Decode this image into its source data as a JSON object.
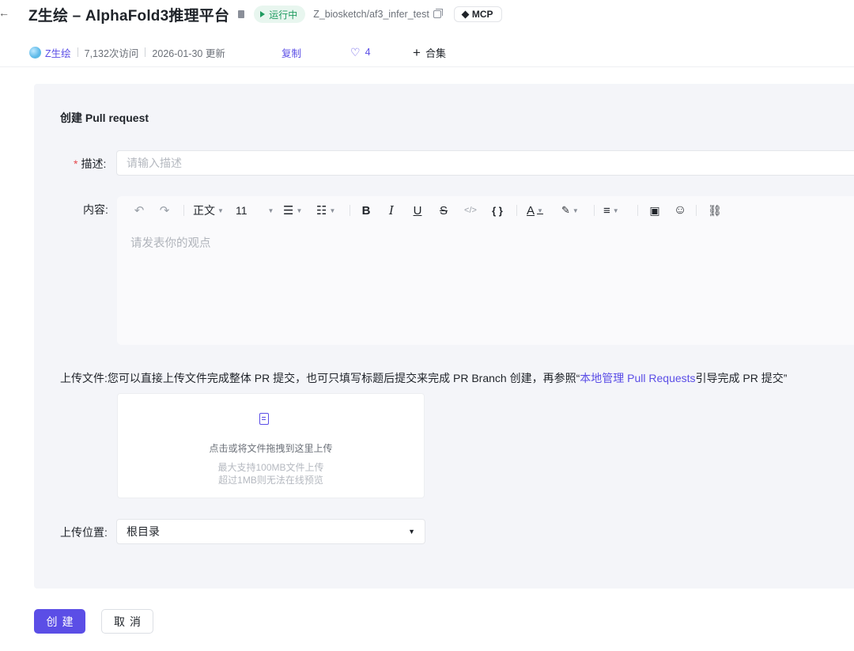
{
  "header": {
    "back_glyph": "←",
    "title": "Z生绘 – AlphaFold3推理平台",
    "status": "运行中",
    "repo_path": "Z_biosketch/af3_infer_test",
    "mcp_label": "MCP"
  },
  "meta": {
    "org_name": "Z生绘",
    "visits": "7,132次访问",
    "updated": "2026-01-30 更新",
    "copy_label": "复制",
    "likes": "4",
    "collection_label": "合集"
  },
  "form": {
    "title": "创建 Pull request",
    "description": {
      "required_mark": "*",
      "label": "描述:",
      "placeholder": "请输入描述",
      "value": ""
    },
    "content": {
      "label": "内容:",
      "placeholder": "请发表你的观点",
      "toolbar": {
        "paragraph_style": "正文",
        "font_size": "11"
      }
    },
    "upload": {
      "label": "上传文件:",
      "hint_prefix": "您可以直接上传文件完成整体 PR 提交，也可只填写标题后提交来完成 PR Branch 创建，再参照“",
      "hint_link": "本地管理 Pull Requests",
      "hint_suffix": "引导完成 PR 提交”",
      "drop_main": "点击或将文件拖拽到这里上传",
      "drop_sub1": "最大支持100MB文件上传",
      "drop_sub2": "超过1MB则无法在线预览"
    },
    "location": {
      "label": "上传位置:",
      "selected": "根目录"
    }
  },
  "actions": {
    "create_label": "创建",
    "cancel_label": "取消"
  },
  "colors": {
    "accent": "#5b4ee6",
    "status_green": "#1f9b60",
    "panel_bg": "#f4f5f9",
    "required_red": "#e5484d"
  }
}
